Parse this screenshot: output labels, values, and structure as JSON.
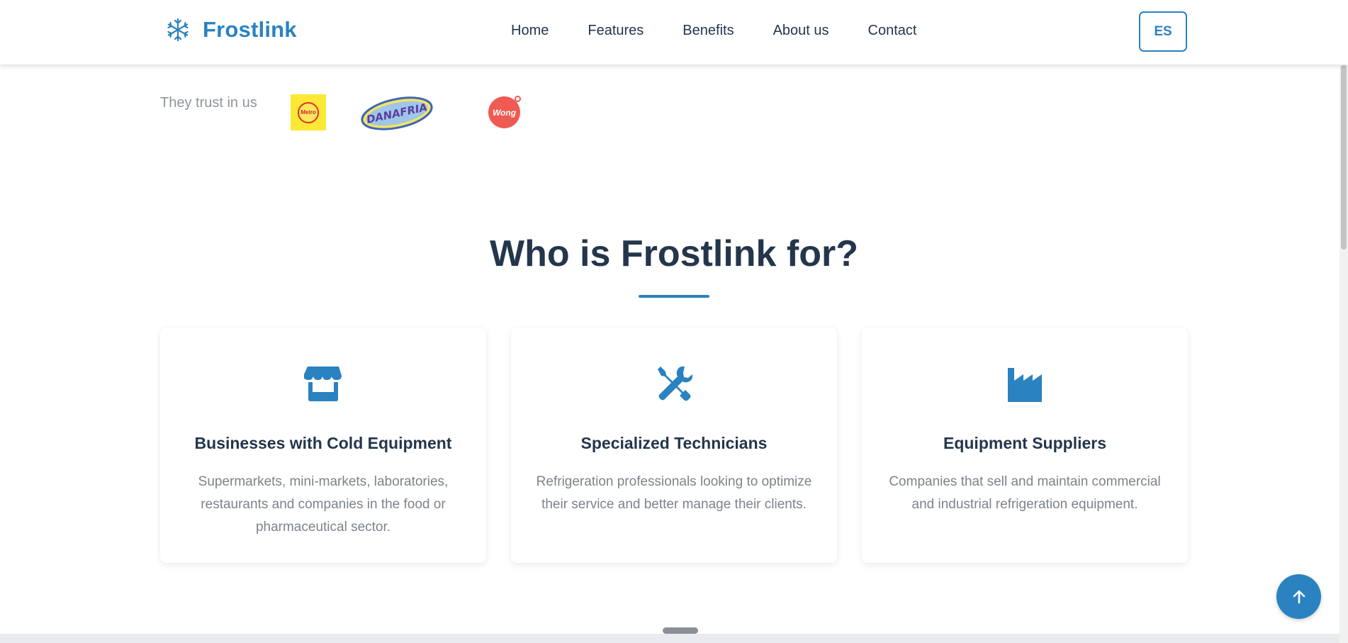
{
  "header": {
    "logo_text": "Frostlink",
    "nav": [
      "Home",
      "Features",
      "Benefits",
      "About us",
      "Contact"
    ],
    "lang_button": "ES"
  },
  "trust": {
    "label": "They trust in us",
    "partners": [
      {
        "name": "Metro",
        "text": "Metro"
      },
      {
        "name": "Danafria",
        "text": "DANAFRIA"
      },
      {
        "name": "Wong",
        "text": "Wong"
      }
    ]
  },
  "section": {
    "title": "Who is Frostlink for?",
    "cards": [
      {
        "icon": "store-icon",
        "title": "Businesses with Cold Equipment",
        "description": "Supermarkets, mini-markets, laboratories, restaurants and companies in the food or pharmaceutical sector."
      },
      {
        "icon": "tools-icon",
        "title": "Specialized Technicians",
        "description": "Refrigeration professionals looking to optimize their service and better manage their clients."
      },
      {
        "icon": "factory-icon",
        "title": "Equipment Suppliers",
        "description": "Companies that sell and maintain commercial and industrial refrigeration equipment."
      }
    ]
  },
  "colors": {
    "accent": "#2a82c0",
    "heading": "#24364b",
    "muted_text": "#7d838a"
  },
  "back_to_top_icon": "arrow-up-icon"
}
